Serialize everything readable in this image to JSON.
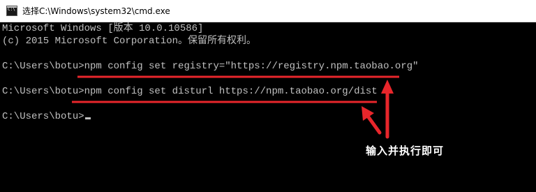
{
  "window": {
    "title": "选择C:\\Windows\\system32\\cmd.exe",
    "icon": "cmd-console-icon",
    "icon_text": "C:\\"
  },
  "console": {
    "lines": [
      "Microsoft Windows [版本 10.0.10586]",
      "(c) 2015 Microsoft Corporation。保留所有权利。",
      "",
      "C:\\Users\\botu>npm config set registry=\"https://registry.npm.taobao.org\"",
      "",
      "C:\\Users\\botu>npm config set disturl https://npm.taobao.org/dist",
      "",
      "C:\\Users\\botu>"
    ],
    "text_color": "#c0c0c0",
    "background_color": "#000000"
  },
  "annotation": {
    "text": "输入并执行即可",
    "color": "#e8262b",
    "text_color": "#ffffff"
  }
}
